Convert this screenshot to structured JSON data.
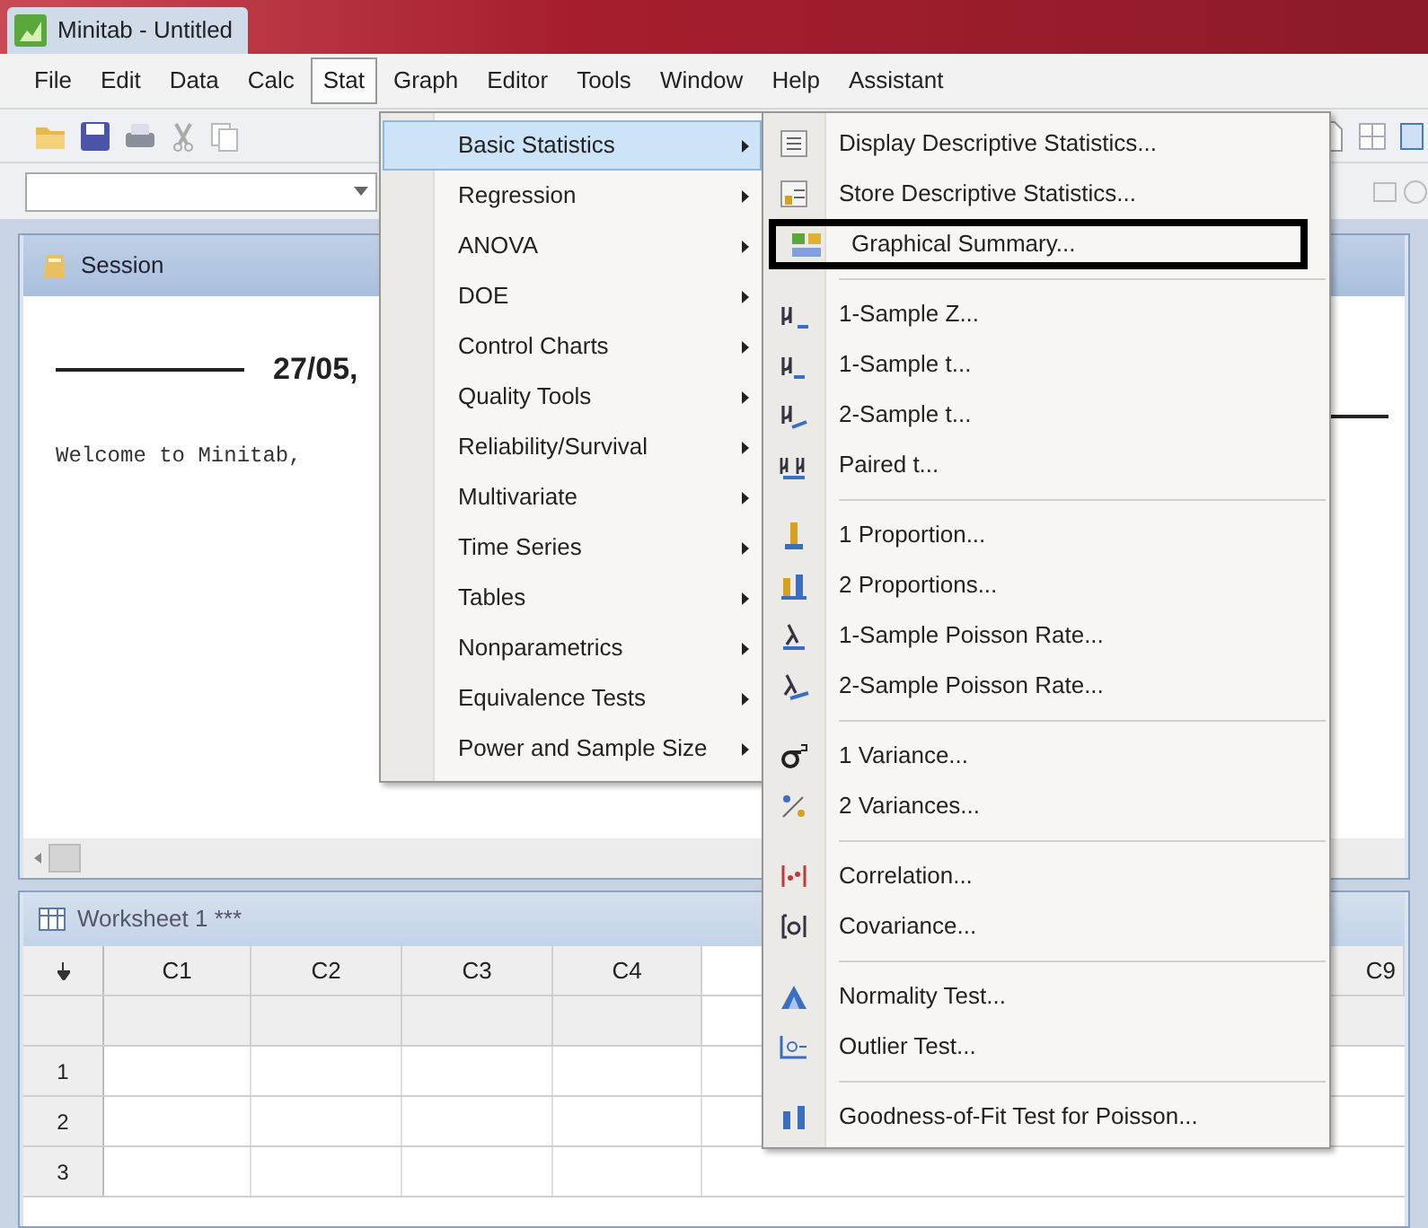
{
  "window": {
    "title": "Minitab - Untitled"
  },
  "menubar": [
    {
      "label": "File",
      "selected": false
    },
    {
      "label": "Edit",
      "selected": false
    },
    {
      "label": "Data",
      "selected": false
    },
    {
      "label": "Calc",
      "selected": false
    },
    {
      "label": "Stat",
      "selected": true
    },
    {
      "label": "Graph",
      "selected": false
    },
    {
      "label": "Editor",
      "selected": false
    },
    {
      "label": "Tools",
      "selected": false
    },
    {
      "label": "Window",
      "selected": false
    },
    {
      "label": "Help",
      "selected": false
    },
    {
      "label": "Assistant",
      "selected": false
    }
  ],
  "stat_menu": [
    {
      "label": "Basic Statistics",
      "selected": true
    },
    {
      "label": "Regression",
      "selected": false
    },
    {
      "label": "ANOVA",
      "selected": false
    },
    {
      "label": "DOE",
      "selected": false
    },
    {
      "label": "Control Charts",
      "selected": false
    },
    {
      "label": "Quality Tools",
      "selected": false
    },
    {
      "label": "Reliability/Survival",
      "selected": false
    },
    {
      "label": "Multivariate",
      "selected": false
    },
    {
      "label": "Time Series",
      "selected": false
    },
    {
      "label": "Tables",
      "selected": false
    },
    {
      "label": "Nonparametrics",
      "selected": false
    },
    {
      "label": "Equivalence Tests",
      "selected": false
    },
    {
      "label": "Power and Sample Size",
      "selected": false
    }
  ],
  "basic_statistics_submenu": [
    {
      "items": [
        {
          "label": "Display Descriptive Statistics...",
          "outlined": false
        },
        {
          "label": "Store Descriptive Statistics...",
          "outlined": false
        },
        {
          "label": "Graphical Summary...",
          "outlined": true
        }
      ]
    },
    {
      "items": [
        {
          "label": "1-Sample Z...",
          "outlined": false
        },
        {
          "label": "1-Sample t...",
          "outlined": false
        },
        {
          "label": "2-Sample t...",
          "outlined": false
        },
        {
          "label": "Paired t...",
          "outlined": false
        }
      ]
    },
    {
      "items": [
        {
          "label": "1 Proportion...",
          "outlined": false
        },
        {
          "label": "2 Proportions...",
          "outlined": false
        },
        {
          "label": "1-Sample Poisson Rate...",
          "outlined": false
        },
        {
          "label": "2-Sample Poisson Rate...",
          "outlined": false
        }
      ]
    },
    {
      "items": [
        {
          "label": "1 Variance...",
          "outlined": false
        },
        {
          "label": "2 Variances...",
          "outlined": false
        }
      ]
    },
    {
      "items": [
        {
          "label": "Correlation...",
          "outlined": false
        },
        {
          "label": "Covariance...",
          "outlined": false
        }
      ]
    },
    {
      "items": [
        {
          "label": "Normality Test...",
          "outlined": false
        },
        {
          "label": "Outlier Test...",
          "outlined": false
        }
      ]
    },
    {
      "items": [
        {
          "label": "Goodness-of-Fit Test for Poisson...",
          "outlined": false
        }
      ]
    }
  ],
  "session": {
    "title": "Session",
    "date": "27/05,",
    "text": "Welcome to Minitab,"
  },
  "worksheet": {
    "title": "Worksheet 1 ***",
    "columns": [
      "C1",
      "C2",
      "C3",
      "C4",
      "C9"
    ],
    "rows": [
      "1",
      "2",
      "3"
    ]
  }
}
